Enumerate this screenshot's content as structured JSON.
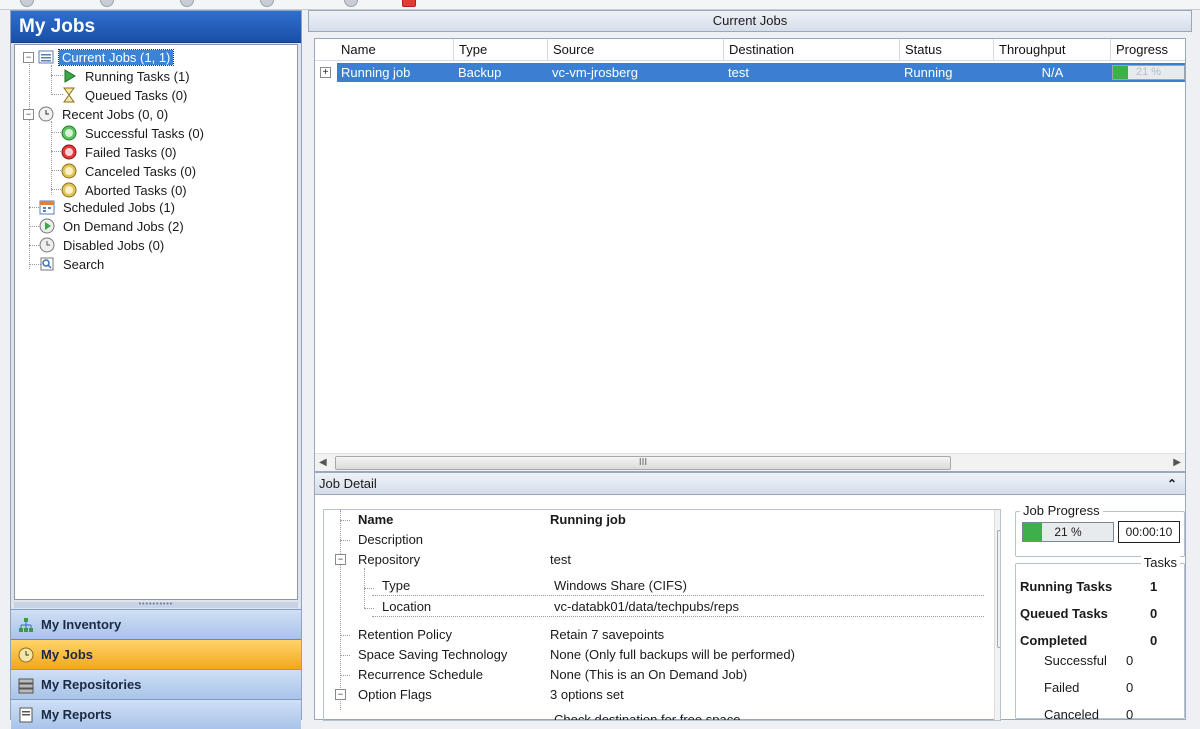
{
  "left": {
    "title": "My Jobs",
    "tree": [
      {
        "label": "Current Jobs (1, 1)",
        "icon": "list-icon"
      },
      {
        "label": "Running Tasks (1)",
        "icon": "play-icon"
      },
      {
        "label": "Queued Tasks (0)",
        "icon": "hourglass-icon"
      },
      {
        "label": "Recent Jobs (0, 0)",
        "icon": "clock-icon"
      },
      {
        "label": "Successful Tasks (0)",
        "icon": "success-icon"
      },
      {
        "label": "Failed Tasks (0)",
        "icon": "failed-icon"
      },
      {
        "label": "Canceled Tasks (0)",
        "icon": "canceled-icon"
      },
      {
        "label": "Aborted Tasks (0)",
        "icon": "aborted-icon"
      },
      {
        "label": "Scheduled Jobs (1)",
        "icon": "calendar-icon"
      },
      {
        "label": "On Demand Jobs (2)",
        "icon": "on-demand-icon"
      },
      {
        "label": "Disabled Jobs (0)",
        "icon": "disabled-icon"
      },
      {
        "label": "Search",
        "icon": "search-icon"
      }
    ],
    "nav": [
      {
        "label": "My Inventory",
        "icon": "inventory-icon"
      },
      {
        "label": "My Jobs",
        "icon": "jobs-icon"
      },
      {
        "label": "My Repositories",
        "icon": "repositories-icon"
      },
      {
        "label": "My Reports",
        "icon": "reports-icon"
      }
    ]
  },
  "current_jobs": {
    "title": "Current Jobs",
    "columns": [
      "Name",
      "Type",
      "Source",
      "Destination",
      "Status",
      "Throughput",
      "Progress"
    ],
    "rows": [
      {
        "name": "Running job",
        "type": "Backup",
        "source": "vc-vm-jrosberg",
        "destination": "test",
        "status": "Running",
        "throughput": "N/A",
        "progress_text": "21 %",
        "progress": 0.21
      }
    ],
    "scroll_thumb": "III"
  },
  "job_detail": {
    "title": "Job Detail",
    "collapse_glyph": "⌃",
    "properties": [
      {
        "key": "Name",
        "value": "Running job"
      },
      {
        "key": "Description",
        "value": ""
      },
      {
        "key": "Repository",
        "value": "test"
      },
      {
        "key": "Type",
        "value": "Windows Share (CIFS)"
      },
      {
        "key": "Location",
        "value": "vc-databk01/data/techpubs/reps"
      },
      {
        "key": "Retention Policy",
        "value": "Retain 7 savepoints"
      },
      {
        "key": "Space Saving Technology",
        "value": "None (Only full backups will be performed)"
      },
      {
        "key": "Recurrence Schedule",
        "value": "None (This is an On Demand Job)"
      },
      {
        "key": "Option Flags",
        "value": "3 options set"
      },
      {
        "key": "",
        "value": "Check destination for free space"
      }
    ],
    "job_progress": {
      "title": "Job Progress",
      "percent_text": "21 %",
      "progress": 0.21,
      "elapsed": "00:00:10"
    },
    "tasks": {
      "title": "Tasks",
      "running_label": "Running Tasks",
      "running_value": "1",
      "queued_label": "Queued Tasks",
      "queued_value": "0",
      "completed_label": "Completed",
      "completed_value": "0",
      "successful_label": "Successful",
      "successful_value": "0",
      "failed_label": "Failed",
      "failed_value": "0",
      "canceled_label": "Canceled",
      "canceled_value": "0"
    }
  }
}
